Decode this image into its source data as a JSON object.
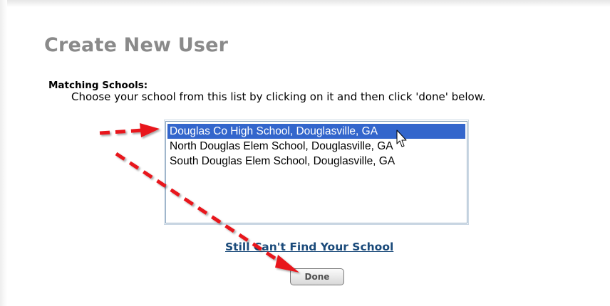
{
  "page": {
    "title": "Create New User"
  },
  "schools": {
    "label": "Matching Schools:",
    "instructions": "Choose your school from this list by clicking on it and then click 'done' below.",
    "options": [
      "Douglas Co High School, Douglasville, GA",
      "North Douglas Elem School, Douglasville, GA",
      "South Douglas Elem School, Douglasville, GA"
    ],
    "selected_index": 0
  },
  "actions": {
    "find_link": "Still Can't Find Your School",
    "done_label": "Done"
  },
  "annotations": {
    "arrow_color": "#e8161c",
    "arrow_style": "dashed",
    "pointer_icon": "mouse-cursor-icon"
  }
}
